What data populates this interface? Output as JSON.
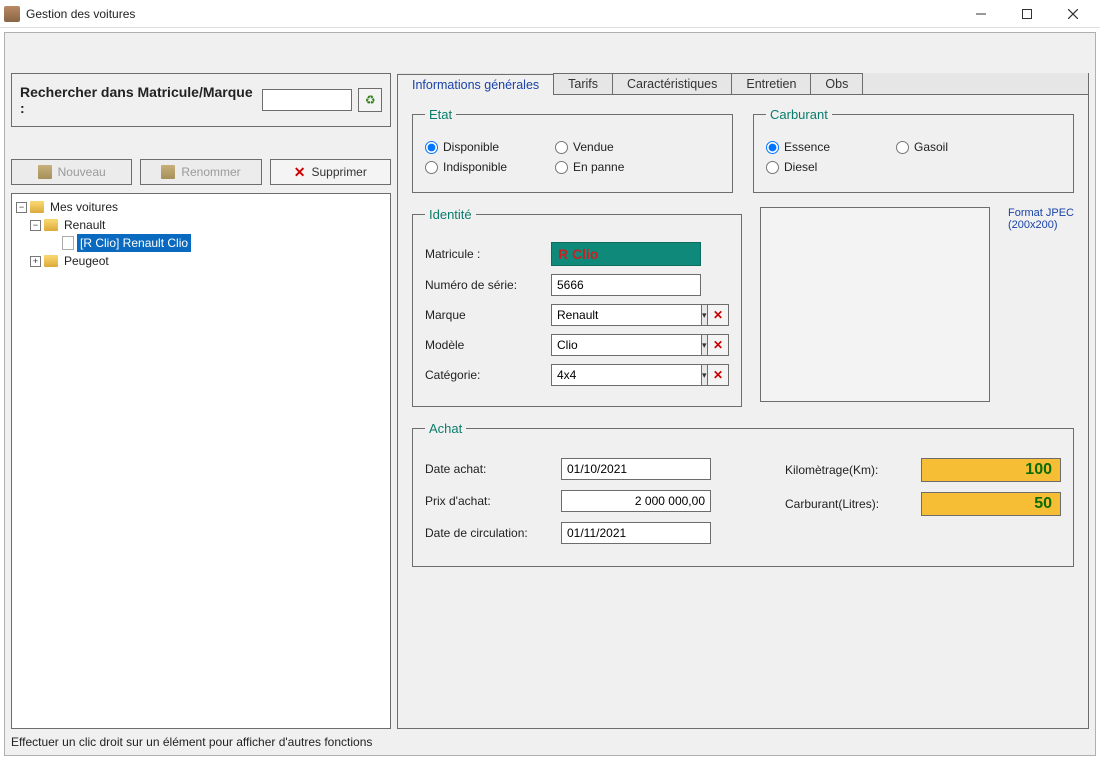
{
  "window": {
    "title": "Gestion des voitures"
  },
  "search": {
    "label": "Rechercher dans Matricule/Marque :",
    "value": ""
  },
  "actions": {
    "new_label": "Nouveau",
    "rename_label": "Renommer",
    "delete_label": "Supprimer"
  },
  "tree": {
    "root": "Mes voitures",
    "renault": "Renault",
    "clio_item": "[R Clio] Renault Clio",
    "peugeot": "Peugeot",
    "toggle_minus": "−",
    "toggle_plus": "+"
  },
  "hint": "Effectuer un clic droit sur un élément pour afficher d'autres fonctions",
  "tabs": {
    "general": "Informations générales",
    "tarifs": "Tarifs",
    "caracteristiques": "Caractéristiques",
    "entretien": "Entretien",
    "obs": "Obs"
  },
  "etat": {
    "legend": "Etat",
    "disponible": "Disponible",
    "vendue": "Vendue",
    "indisponible": "Indisponible",
    "enpanne": "En panne"
  },
  "carburant": {
    "legend": "Carburant",
    "essence": "Essence",
    "gasoil": "Gasoil",
    "diesel": "Diesel"
  },
  "identite": {
    "legend": "Identité",
    "matricule_label": "Matricule :",
    "matricule_value": "R Clio",
    "numserie_label": "Numéro de série:",
    "numserie_value": "5666",
    "marque_label": "Marque",
    "marque_value": "Renault",
    "modele_label": "Modèle",
    "modele_value": "Clio",
    "categorie_label": "Catégorie:",
    "categorie_value": "4x4",
    "photo_hint1": "Format JPEC",
    "photo_hint2": "(200x200)"
  },
  "achat": {
    "legend": "Achat",
    "date_achat_label": "Date achat:",
    "date_achat_value": "01/10/2021",
    "prix_label": "Prix d'achat:",
    "prix_value": "2 000 000,00",
    "date_circ_label": "Date de circulation:",
    "date_circ_value": "01/11/2021",
    "km_label": "Kilomètrage(Km):",
    "km_value": "100",
    "litres_label": "Carburant(Litres):",
    "litres_value": "50"
  }
}
